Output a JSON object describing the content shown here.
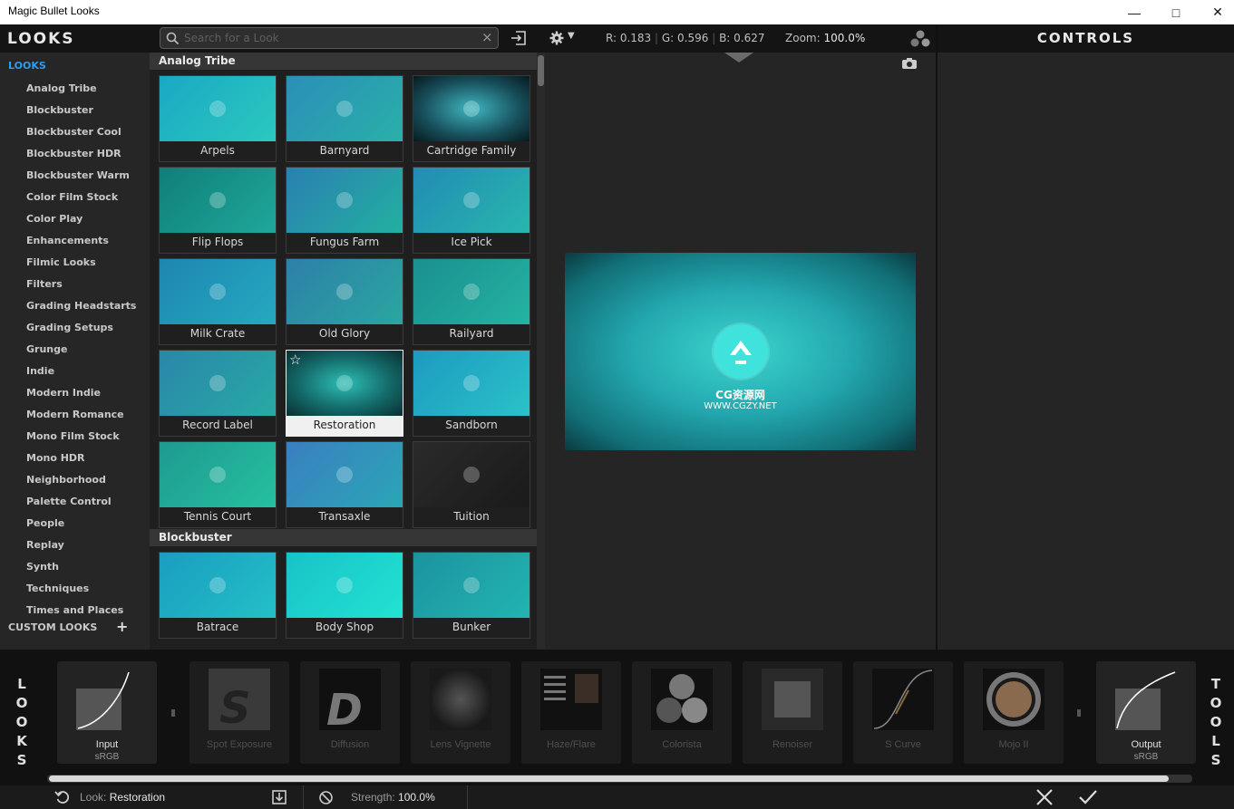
{
  "window": {
    "title": "Magic Bullet Looks"
  },
  "left_nav": {
    "header": "LOOKS",
    "section": "LOOKS",
    "items": [
      "Analog Tribe",
      "Blockbuster",
      "Blockbuster Cool",
      "Blockbuster HDR",
      "Blockbuster Warm",
      "Color Film Stock",
      "Color Play",
      "Enhancements",
      "Filmic Looks",
      "Filters",
      "Grading Headstarts",
      "Grading Setups",
      "Grunge",
      "Indie",
      "Modern Indie",
      "Modern Romance",
      "Mono Film Stock",
      "Mono HDR",
      "Neighborhood",
      "Palette Control",
      "People",
      "Replay",
      "Synth",
      "Techniques",
      "Times and Places"
    ],
    "custom": "CUSTOM LOOKS",
    "add": "+"
  },
  "search": {
    "placeholder": "Search for a Look",
    "value": "",
    "clear": "×"
  },
  "grid": {
    "categories": [
      {
        "name": "Analog Tribe",
        "looks": [
          "Arpels",
          "Barnyard",
          "Cartridge Family",
          "Flip Flops",
          "Fungus Farm",
          "Ice Pick",
          "Milk Crate",
          "Old Glory",
          "Railyard",
          "Record Label",
          "Restoration",
          "Sandborn",
          "Tennis Court",
          "Transaxle",
          "Tuition"
        ]
      },
      {
        "name": "Blockbuster",
        "looks": [
          "Batrace",
          "Body Shop",
          "Bunker"
        ]
      }
    ],
    "selected": "Restoration",
    "favorite_icon": "☆"
  },
  "viewer": {
    "r": "R: 0.183",
    "g": "G: 0.596",
    "b": "B: 0.627",
    "zoom_label": "Zoom:",
    "zoom": "100.0%",
    "wm1": "CG资源网",
    "wm2": "WWW.CGZY.NET"
  },
  "controls": {
    "header": "CONTROLS"
  },
  "chain": {
    "looks_letters": [
      "L",
      "O",
      "O",
      "K",
      "S"
    ],
    "tools_letters": [
      "T",
      "O",
      "O",
      "L",
      "S"
    ],
    "tools": [
      {
        "name": "Input",
        "sub": "sRGB",
        "on": true
      },
      {
        "name": "Spot Exposure",
        "sub": "",
        "on": false
      },
      {
        "name": "Diffusion",
        "sub": "",
        "on": false
      },
      {
        "name": "Lens Vignette",
        "sub": "",
        "on": false
      },
      {
        "name": "Haze/Flare",
        "sub": "",
        "on": false
      },
      {
        "name": "Colorista",
        "sub": "",
        "on": false
      },
      {
        "name": "Renoiser",
        "sub": "",
        "on": false
      },
      {
        "name": "S Curve",
        "sub": "",
        "on": false
      },
      {
        "name": "Mojo II",
        "sub": "",
        "on": false
      },
      {
        "name": "Output",
        "sub": "sRGB",
        "on": true
      }
    ]
  },
  "status": {
    "look_label": "Look:",
    "look_value": "Restoration",
    "strength_label": "Strength:",
    "strength_value": "100.0%"
  },
  "colors": {
    "accent": "#2d9df0",
    "panel": "#262626"
  }
}
